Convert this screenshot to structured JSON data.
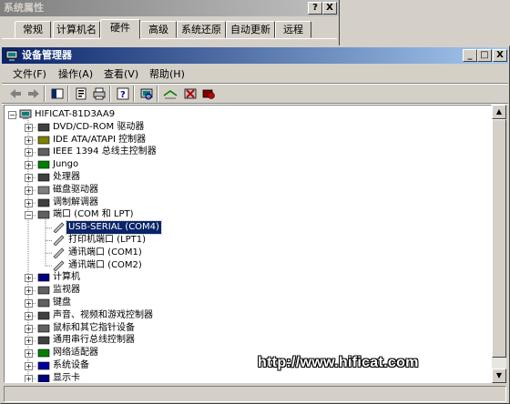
{
  "background_window": {
    "title": "系统属性",
    "help_label": "?",
    "close_label": "X",
    "tabs": [
      {
        "label": "常规",
        "active": false
      },
      {
        "label": "计算机名",
        "active": false
      },
      {
        "label": "硬件",
        "active": true
      },
      {
        "label": "高级",
        "active": false
      },
      {
        "label": "系统还原",
        "active": false
      },
      {
        "label": "自动更新",
        "active": false
      },
      {
        "label": "远程",
        "active": false
      }
    ]
  },
  "device_manager": {
    "title": "设备管理器",
    "caption_buttons": {
      "minimize": "_",
      "maximize": "□",
      "close": "X"
    },
    "menu": [
      {
        "label": "文件(F)"
      },
      {
        "label": "操作(A)"
      },
      {
        "label": "查看(V)"
      },
      {
        "label": "帮助(H)"
      }
    ],
    "toolbar_icons": [
      "back-icon",
      "forward-icon",
      "show-hide-icon",
      "properties-icon",
      "print-icon",
      "help-icon",
      "scan-hardware-icon",
      "update-driver-icon",
      "uninstall-icon",
      "disable-icon"
    ],
    "tree": {
      "root": "HIFICAT-81D3AA9",
      "items": [
        {
          "label": "DVD/CD-ROM 驱动器",
          "icon": "cdrom-icon",
          "expanded": false
        },
        {
          "label": "IDE ATA/ATAPI 控制器",
          "icon": "ide-controller-icon",
          "expanded": false
        },
        {
          "label": "IEEE 1394 总线主控制器",
          "icon": "ieee1394-icon",
          "expanded": false
        },
        {
          "label": "Jungo",
          "icon": "jungo-icon",
          "expanded": false
        },
        {
          "label": "处理器",
          "icon": "processor-icon",
          "expanded": false
        },
        {
          "label": "磁盘驱动器",
          "icon": "disk-drive-icon",
          "expanded": false
        },
        {
          "label": "调制解调器",
          "icon": "modem-icon",
          "expanded": false
        },
        {
          "label": "端口 (COM 和 LPT)",
          "icon": "port-icon",
          "expanded": true,
          "children": [
            {
              "label": "USB-SERIAL (COM4)",
              "selected": true
            },
            {
              "label": "打印机端口 (LPT1)",
              "selected": false
            },
            {
              "label": "通讯端口 (COM1)",
              "selected": false
            },
            {
              "label": "通讯端口 (COM2)",
              "selected": false
            }
          ]
        },
        {
          "label": "计算机",
          "icon": "computer-icon",
          "expanded": false
        },
        {
          "label": "监视器",
          "icon": "monitor-icon",
          "expanded": false
        },
        {
          "label": "键盘",
          "icon": "keyboard-icon",
          "expanded": false
        },
        {
          "label": "声音、视频和游戏控制器",
          "icon": "sound-icon",
          "expanded": false
        },
        {
          "label": "鼠标和其它指针设备",
          "icon": "mouse-icon",
          "expanded": false
        },
        {
          "label": "通用串行总线控制器",
          "icon": "usb-icon",
          "expanded": false
        },
        {
          "label": "网络适配器",
          "icon": "network-adapter-icon",
          "expanded": false
        },
        {
          "label": "系统设备",
          "icon": "system-devices-icon",
          "expanded": false
        },
        {
          "label": "显示卡",
          "icon": "display-adapter-icon",
          "expanded": false
        }
      ]
    }
  },
  "watermark": "http://www.hificat.com",
  "colors": {
    "active_title": "#0a246a",
    "inactive_title": "#808080",
    "face": "#d4d0c8",
    "selection": "#0a246a"
  }
}
